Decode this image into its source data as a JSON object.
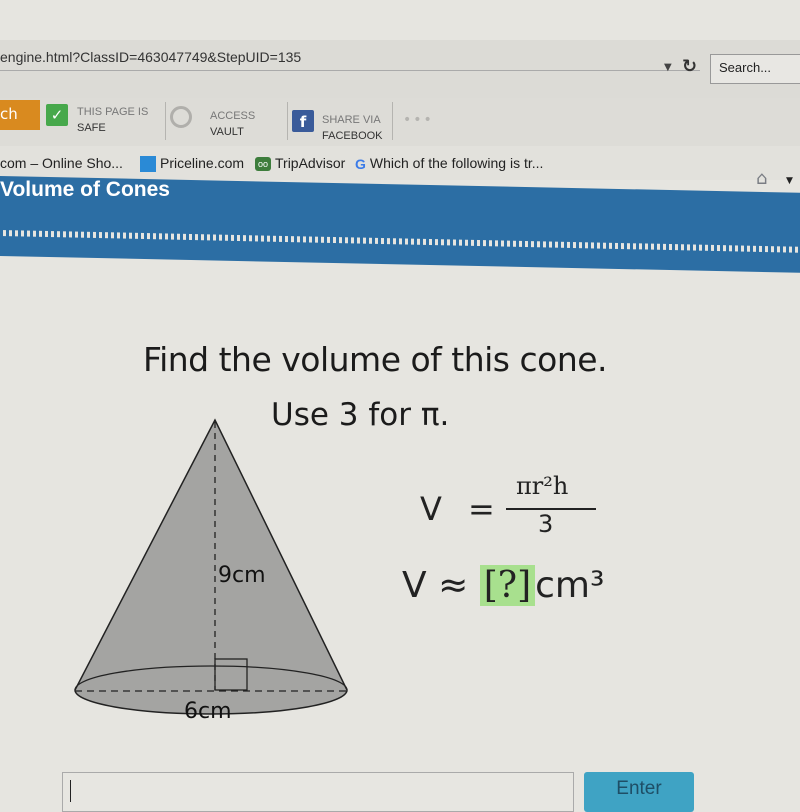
{
  "browser": {
    "url": "engine.html?ClassID=463047749&StepUID=135",
    "search_placeholder": "Search...",
    "toolbar": {
      "search_label": "ch",
      "safe": {
        "line1": "THIS PAGE IS",
        "line2": "SAFE"
      },
      "vault": {
        "line1": "ACCESS",
        "line2": "VAULT"
      },
      "facebook": {
        "line1": "SHARE VIA",
        "line2": "FACEBOOK"
      },
      "more": "•••"
    },
    "bookmarks": [
      {
        "label": "com – Online Sho..."
      },
      {
        "label": "Priceline.com"
      },
      {
        "label": "TripAdvisor"
      },
      {
        "label": "Which of the following is tr..."
      }
    ]
  },
  "lesson": {
    "title": "Volume of Cones",
    "question": "Find the volume of this cone.",
    "instruction": "Use 3 for π.",
    "figure": {
      "height_label": "9cm",
      "diameter_label": "6cm"
    },
    "formula": {
      "lhs": "V",
      "eq": "=",
      "numerator": "πr²h",
      "denominator": "3"
    },
    "answer": {
      "lhs": "V",
      "approx": "≈",
      "placeholder": "[?]",
      "unit": "cm³"
    },
    "input_value": "",
    "enter_label": "Enter"
  },
  "colors": {
    "banner": "#2c6ea4",
    "answer_highlight": "#a8e08e",
    "enter_button": "#3fa3c4"
  }
}
